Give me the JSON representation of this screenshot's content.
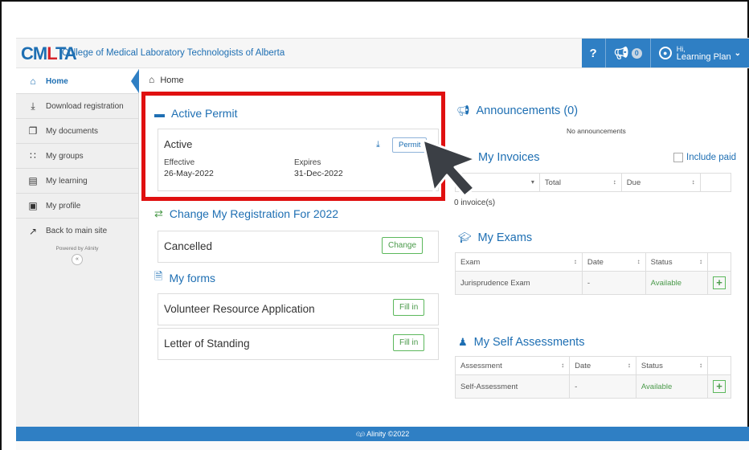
{
  "header": {
    "logo_text": "CMLTA",
    "org_name": "College of Medical Laboratory Technologists of Alberta",
    "help_label": "?",
    "announcement_count": "0",
    "user_greeting": "Hi,",
    "user_name": "Learning Plan"
  },
  "sidebar": {
    "items": [
      {
        "label": "Home",
        "icon": "home-icon"
      },
      {
        "label": "Download registration",
        "icon": "download-icon"
      },
      {
        "label": "My documents",
        "icon": "documents-icon"
      },
      {
        "label": "My groups",
        "icon": "groups-icon"
      },
      {
        "label": "My learning",
        "icon": "book-icon"
      },
      {
        "label": "My profile",
        "icon": "id-card-icon"
      },
      {
        "label": "Back to main site",
        "icon": "external-link-icon"
      }
    ],
    "powered_by": "Powered by Alinity",
    "collapse_label": "«"
  },
  "breadcrumb": {
    "label": "Home"
  },
  "active_permit": {
    "title": "Active Permit",
    "status": "Active",
    "permit_button": "Permit",
    "effective_label": "Effective",
    "effective_date": "26-May-2022",
    "expires_label": "Expires",
    "expires_date": "31-Dec-2022"
  },
  "change_registration": {
    "title": "Change My Registration For 2022",
    "status": "Cancelled",
    "button": "Change"
  },
  "forms": {
    "title": "My forms",
    "items": [
      {
        "label": "Volunteer Resource Application",
        "button": "Fill in"
      },
      {
        "label": "Letter of Standing",
        "button": "Fill in"
      }
    ]
  },
  "announcements": {
    "title": "Announcements (0)",
    "empty": "No announcements"
  },
  "invoices": {
    "title": "My Invoices",
    "include_paid": "Include paid",
    "columns": [
      "#",
      "Total",
      "Due"
    ],
    "count": "0 invoice(s)"
  },
  "exams": {
    "title": "My Exams",
    "columns": [
      "Exam",
      "Date",
      "Status"
    ],
    "rows": [
      {
        "exam": "Jurisprudence Exam",
        "date": "-",
        "status": "Available"
      }
    ]
  },
  "self_assessments": {
    "title": "My Self Assessments",
    "columns": [
      "Assessment",
      "Date",
      "Status"
    ],
    "rows": [
      {
        "assessment": "Self-Assessment",
        "date": "-",
        "status": "Available"
      }
    ]
  },
  "footer": {
    "text": "Alinity ©2022"
  },
  "colors": {
    "primary": "#2f7fc4",
    "brand_red": "#d6232a",
    "highlight_red": "#e01010",
    "success_green": "#4a9a4a"
  }
}
